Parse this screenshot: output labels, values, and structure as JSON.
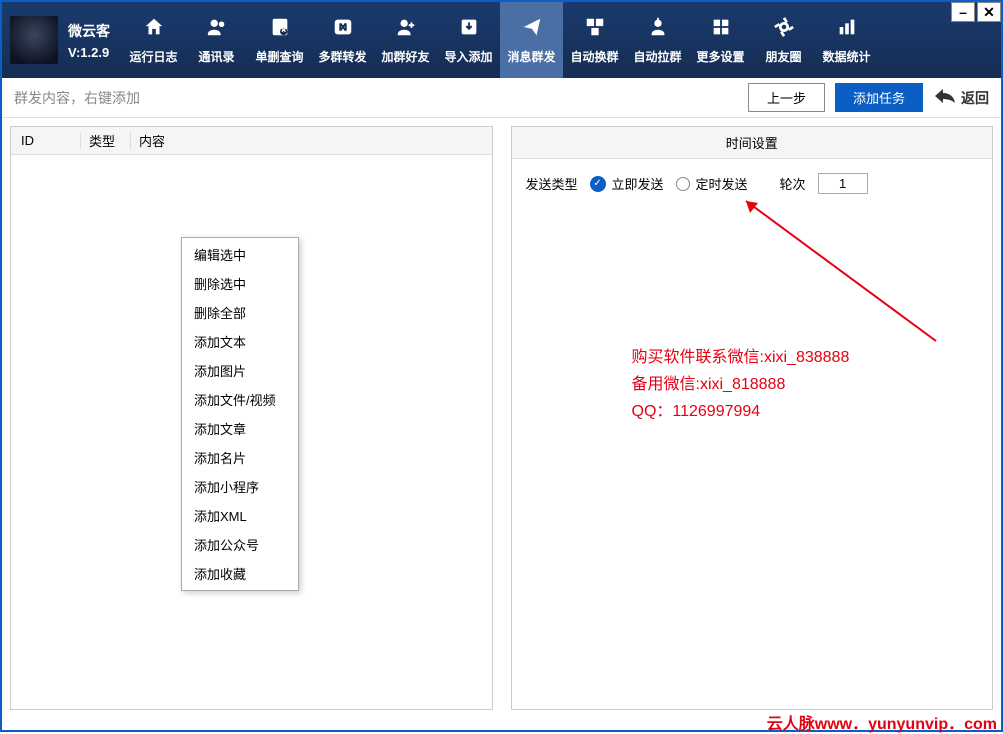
{
  "app": {
    "name": "微云客",
    "version": "V:1.2.9"
  },
  "toolbar": [
    {
      "label": "运行日志",
      "icon": "home"
    },
    {
      "label": "通讯录",
      "icon": "contacts"
    },
    {
      "label": "单删查询",
      "icon": "query"
    },
    {
      "label": "多群转发",
      "icon": "forward"
    },
    {
      "label": "加群好友",
      "icon": "addfriend"
    },
    {
      "label": "导入添加",
      "icon": "import"
    },
    {
      "label": "消息群发",
      "icon": "send",
      "active": true
    },
    {
      "label": "自动换群",
      "icon": "swap"
    },
    {
      "label": "自动拉群",
      "icon": "pull"
    },
    {
      "label": "更多设置",
      "icon": "settings"
    },
    {
      "label": "朋友圈",
      "icon": "moments"
    },
    {
      "label": "数据统计",
      "icon": "stats"
    }
  ],
  "actionBar": {
    "hint": "群发内容，右键添加",
    "prev": "上一步",
    "addTask": "添加任务",
    "back": "返回"
  },
  "leftPanel": {
    "columns": {
      "id": "ID",
      "type": "类型",
      "content": "内容"
    }
  },
  "contextMenu": [
    "编辑选中",
    "删除选中",
    "删除全部",
    "添加文本",
    "添加图片",
    "添加文件/视频",
    "添加文章",
    "添加名片",
    "添加小程序",
    "添加XML",
    "添加公众号",
    "添加收藏"
  ],
  "rightPanel": {
    "title": "时间设置",
    "sendTypeLabel": "发送类型",
    "immediate": "立即发送",
    "scheduled": "定时发送",
    "roundsLabel": "轮次",
    "roundsValue": "1"
  },
  "annotation": {
    "line1": "购买软件联系微信:xixi_838888",
    "line2": "备用微信:xixi_818888",
    "line3": "QQ：1126997994"
  },
  "watermark": {
    "text1": "云人脉",
    "text2": "www．yunyunvip．com"
  }
}
